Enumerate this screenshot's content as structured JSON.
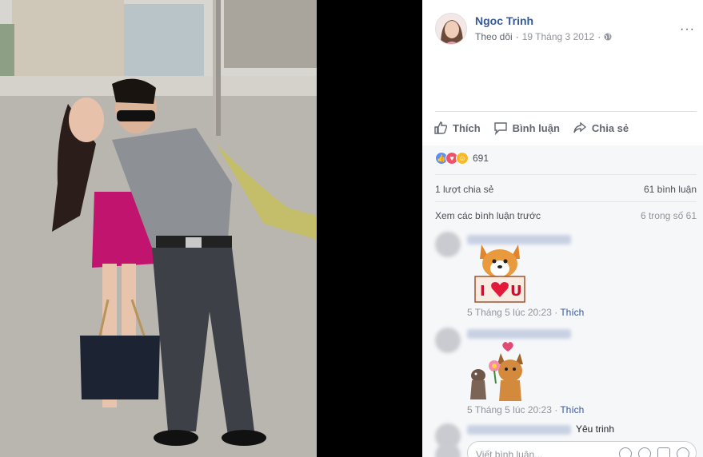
{
  "post": {
    "author": "Ngoc Trinh",
    "follow": "Theo dõi",
    "date": "19 Tháng 3 2012",
    "more": "···"
  },
  "actions": {
    "like": "Thích",
    "comment": "Bình luận",
    "share": "Chia sẻ"
  },
  "stats": {
    "reactions": "691",
    "shares": "1 lượt chia sẻ",
    "comments": "61 bình luận",
    "view_previous": "Xem các bình luận trước",
    "page": "6 trong số 61"
  },
  "comments": [
    {
      "time": "5 Tháng 5 lúc 20:23",
      "separator": " · ",
      "like": "Thích",
      "text": ""
    },
    {
      "time": "5 Tháng 5 lúc 20:23",
      "separator": " · ",
      "like": "Thích",
      "text": ""
    },
    {
      "time": "",
      "separator": "",
      "like": "",
      "text": "Yêu trinh"
    }
  ],
  "composer": {
    "placeholder": "Viết bình luận..."
  },
  "colors": {
    "link": "#365899",
    "like_blue": "#5890ff",
    "love_red": "#f25268",
    "haha_yellow": "#f7b928"
  }
}
